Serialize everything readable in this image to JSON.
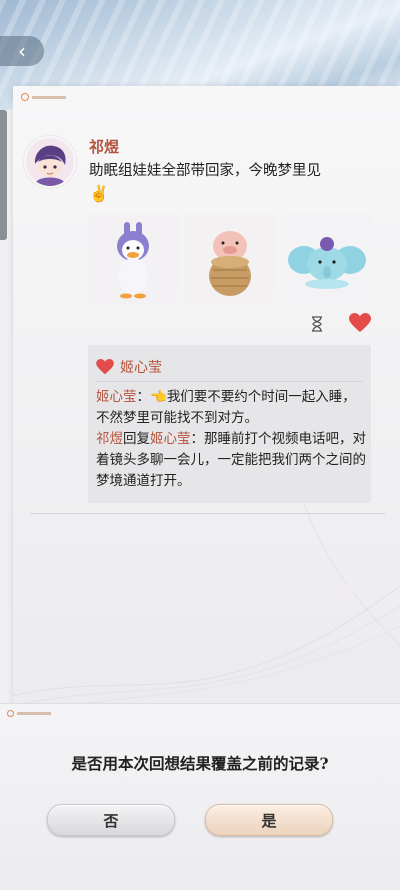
{
  "post": {
    "author": "祁煜",
    "text": "助眠组娃娃全部带回家，今晚梦里见",
    "emoji": "✌️",
    "photos": [
      "duck-plush",
      "peanut-pig-plush",
      "elephant-plush"
    ]
  },
  "likes": {
    "liker": "姬心莹"
  },
  "comments": [
    {
      "name": "姬心莹",
      "sep": "：",
      "emoji": "👈",
      "text": "我们要不要约个时间一起入睡，不然梦里可能找不到对方。"
    },
    {
      "name": "祁煜",
      "reply_word": "回复",
      "target": "姬心莹",
      "sep": "：",
      "text": "那睡前打个视频电话吧，对着镜头多聊一会儿，一定能把我们两个之间的梦境通道打开。"
    }
  ],
  "dialog": {
    "question": "是否用本次回想结果覆盖之前的记录?",
    "no_label": "否",
    "yes_label": "是"
  },
  "colors": {
    "name_accent": "#b5533c",
    "heart": "#e44b4b"
  }
}
